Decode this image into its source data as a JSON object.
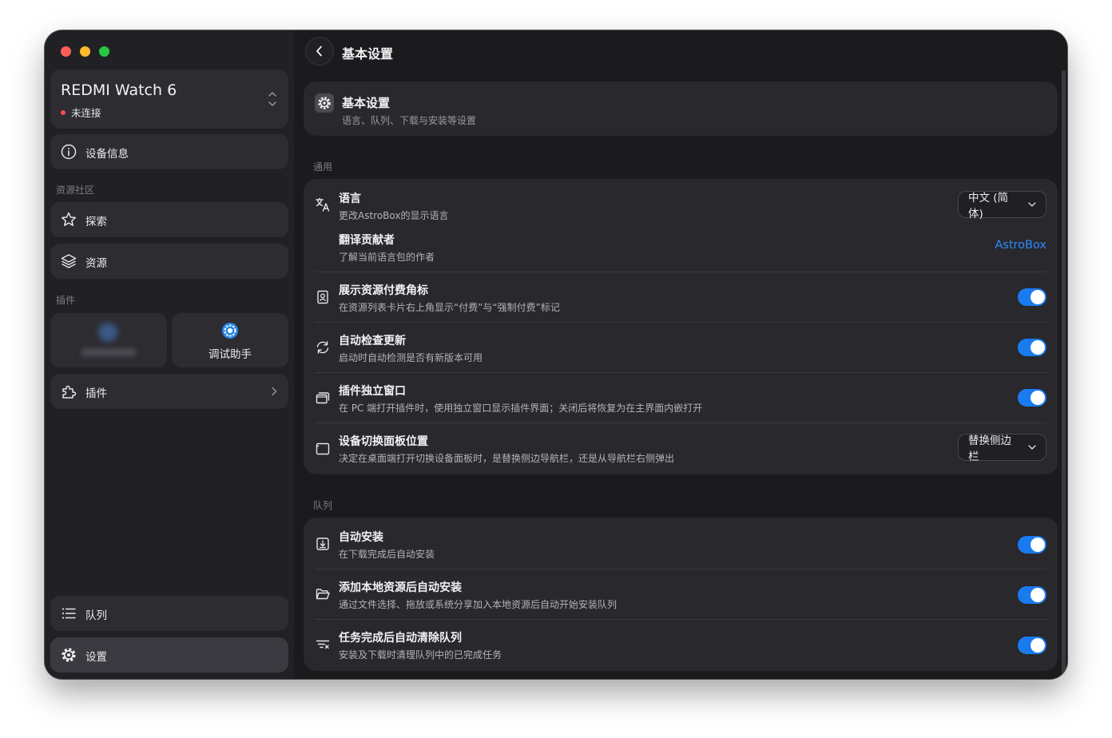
{
  "sidebar": {
    "device": {
      "name": "REDMI Watch 6",
      "status": "未连接",
      "status_color": "#ff4d4f"
    },
    "device_info_label": "设备信息",
    "community_section": "资源社区",
    "explore_label": "探索",
    "resources_label": "资源",
    "plugins_section": "插件",
    "debug_helper_label": "调试助手",
    "plugins_label": "插件",
    "queue_label": "队列",
    "settings_label": "设置"
  },
  "main": {
    "page_title": "基本设置",
    "header": {
      "title": "基本设置",
      "description": "语言、队列、下载与安装等设置"
    },
    "general_group": "通用",
    "general_rows": [
      {
        "icon": "translate-icon",
        "title": "语言",
        "description": "更改AstroBox的显示语言",
        "control": "select",
        "value": "中文 (简体)"
      },
      {
        "icon": "",
        "title": "翻译贡献者",
        "description": "了解当前语言包的作者",
        "control": "link",
        "value": "AstroBox"
      },
      {
        "icon": "badge-icon",
        "title": "展示资源付费角标",
        "description": "在资源列表卡片右上角显示“付费”与“强制付费”标记",
        "control": "toggle",
        "on": true
      },
      {
        "icon": "refresh-icon",
        "title": "自动检查更新",
        "description": "启动时自动检测是否有新版本可用",
        "control": "toggle",
        "on": true
      },
      {
        "icon": "windows-icon",
        "title": "插件独立窗口",
        "description": "在 PC 端打开插件时，使用独立窗口显示插件界面；关闭后将恢复为在主界面内嵌打开",
        "control": "toggle",
        "on": true
      },
      {
        "icon": "panel-icon",
        "title": "设备切换面板位置",
        "description": "决定在桌面端打开切换设备面板时，是替换侧边导航栏，还是从导航栏右侧弹出",
        "control": "select",
        "value": "替换侧边栏"
      }
    ],
    "queue_group": "队列",
    "queue_rows": [
      {
        "icon": "install-icon",
        "title": "自动安装",
        "description": "在下载完成后自动安装",
        "control": "toggle",
        "on": true
      },
      {
        "icon": "folder-icon",
        "title": "添加本地资源后自动安装",
        "description": "通过文件选择、拖放或系统分享加入本地资源后自动开始安装队列",
        "control": "toggle",
        "on": true
      },
      {
        "icon": "clear-queue-icon",
        "title": "任务完成后自动清除队列",
        "description": "安装及下载时清理队列中的已完成任务",
        "control": "toggle",
        "on": true
      }
    ]
  },
  "colors": {
    "accent": "#1a7bf0",
    "link": "#2d8cff",
    "background": "#1b1b1e",
    "sidebar": "#212125"
  }
}
